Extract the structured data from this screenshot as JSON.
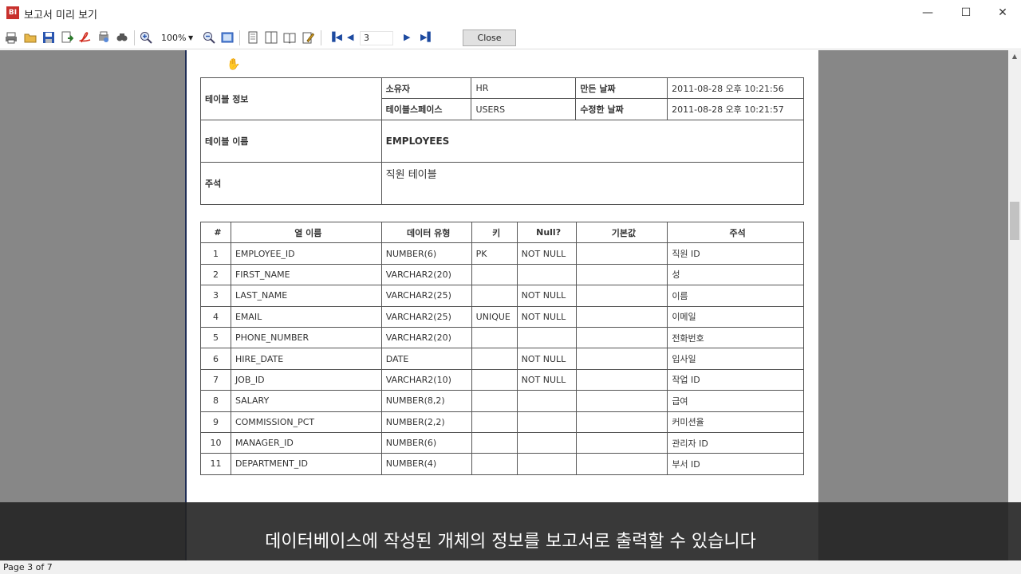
{
  "window": {
    "app_icon_text": "BI",
    "title": "보고서 미리 보기",
    "minimize": "—",
    "maximize": "☐",
    "close": "✕"
  },
  "toolbar": {
    "zoom": "100%",
    "page_value": "3",
    "close_label": "Close",
    "icons": [
      "print-icon",
      "open-icon",
      "save-icon",
      "export-icon",
      "pdf-icon",
      "print-setup-icon",
      "find-icon",
      "zoom-in-icon",
      "zoom-out-icon",
      "fit-page-icon",
      "single-page-icon",
      "multi-page-icon",
      "book-icon",
      "edit-icon",
      "first-page-icon",
      "prev-page-icon",
      "next-page-icon",
      "last-page-icon"
    ]
  },
  "report": {
    "info": {
      "table_info_label": "테이블 정보",
      "owner_label": "소유자",
      "owner_value": "HR",
      "created_label": "만든 날짜",
      "created_value": "2011-08-28 오후 10:21:56",
      "tablespace_label": "테이블스페이스",
      "tablespace_value": "USERS",
      "modified_label": "수정한 날짜",
      "modified_value": "2011-08-28 오후 10:21:57",
      "table_name_label": "테이블 이름",
      "table_name_value": "EMPLOYEES",
      "comment_label": "주석",
      "comment_value": "직원 테이블"
    },
    "columns": {
      "headers": [
        "#",
        "열 이름",
        "데이터 유형",
        "키",
        "Null?",
        "기본값",
        "주석"
      ],
      "rows": [
        [
          "1",
          "EMPLOYEE_ID",
          "NUMBER(6)",
          "PK",
          "NOT NULL",
          "",
          "직원 ID"
        ],
        [
          "2",
          "FIRST_NAME",
          "VARCHAR2(20)",
          "",
          "",
          "",
          "성"
        ],
        [
          "3",
          "LAST_NAME",
          "VARCHAR2(25)",
          "",
          "NOT NULL",
          "",
          "이름"
        ],
        [
          "4",
          "EMAIL",
          "VARCHAR2(25)",
          "UNIQUE",
          "NOT NULL",
          "",
          "이메일"
        ],
        [
          "5",
          "PHONE_NUMBER",
          "VARCHAR2(20)",
          "",
          "",
          "",
          "전화번호"
        ],
        [
          "6",
          "HIRE_DATE",
          "DATE",
          "",
          "NOT NULL",
          "",
          "입사일"
        ],
        [
          "7",
          "JOB_ID",
          "VARCHAR2(10)",
          "",
          "NOT NULL",
          "",
          "작업 ID"
        ],
        [
          "8",
          "SALARY",
          "NUMBER(8,2)",
          "",
          "",
          "",
          "급여"
        ],
        [
          "9",
          "COMMISSION_PCT",
          "NUMBER(2,2)",
          "",
          "",
          "",
          "커미션율"
        ],
        [
          "10",
          "MANAGER_ID",
          "NUMBER(6)",
          "",
          "",
          "",
          "관리자 ID"
        ],
        [
          "11",
          "DEPARTMENT_ID",
          "NUMBER(4)",
          "",
          "",
          "",
          "부서 ID"
        ]
      ]
    }
  },
  "subtitle": "데이터베이스에 작성된 개체의 정보를 보고서로 출력할 수 있습니다",
  "status": {
    "page_text": "Page 3 of 7"
  }
}
